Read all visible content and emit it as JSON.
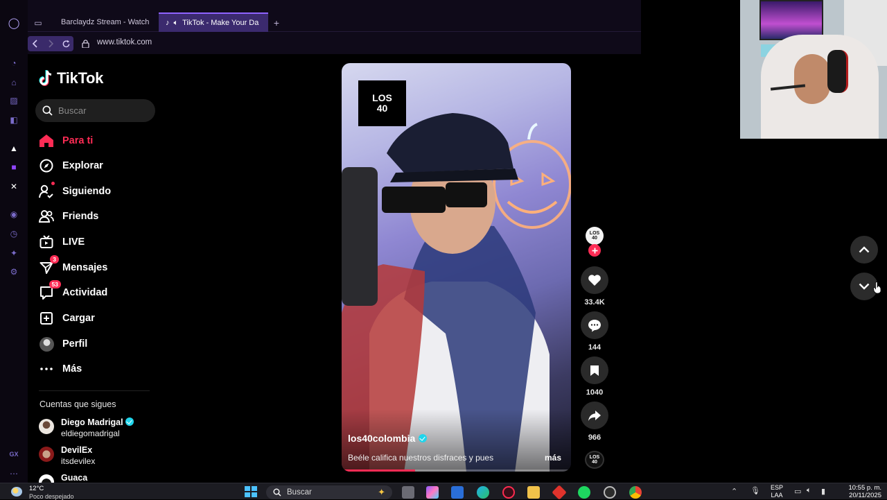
{
  "browser": {
    "tabs": [
      {
        "label": "Barclaydz Stream - Watch",
        "favicon": "kick-logo-icon",
        "color": "#53fc18"
      },
      {
        "label": "TikTok - Make Your Da",
        "favicon": "tiktok-logo-icon",
        "active": true
      }
    ],
    "new_tab_label": "+",
    "url": "www.tiktok.com"
  },
  "tiktok": {
    "logo_text": "TikTok",
    "search": {
      "placeholder": "Buscar"
    },
    "nav": [
      {
        "label": "Para ti",
        "icon": "home-icon",
        "active": true
      },
      {
        "label": "Explorar",
        "icon": "compass-icon"
      },
      {
        "label": "Siguiendo",
        "icon": "following-icon"
      },
      {
        "label": "Friends",
        "icon": "friends-icon"
      },
      {
        "label": "LIVE",
        "icon": "live-tv-icon"
      },
      {
        "label": "Mensajes",
        "icon": "messages-icon",
        "badge": "3"
      },
      {
        "label": "Actividad",
        "icon": "activity-icon",
        "badge": "53"
      },
      {
        "label": "Cargar",
        "icon": "upload-icon"
      },
      {
        "label": "Perfil",
        "icon": "profile-avatar"
      },
      {
        "label": "Más",
        "icon": "more-icon"
      }
    ],
    "following_header": "Cuentas que sigues",
    "following": [
      {
        "name": "Diego Madrigal",
        "username": "eldiegomadrigal",
        "verified": true
      },
      {
        "name": "DevilEx",
        "username": "itsdevilex",
        "verified": false
      },
      {
        "name": "Guaca",
        "username": "",
        "verified": false
      }
    ],
    "video": {
      "brand_logo_text": "LOS 40",
      "author": "los40colombia",
      "verified": true,
      "caption": "Beéle califica nuestros disfraces y pues",
      "more_label": "más",
      "progress": 0.32
    },
    "actions": {
      "likes": "33.4K",
      "comments": "144",
      "saves": "1040",
      "shares": "966"
    },
    "accent_color": "#fe2c55"
  },
  "taskbar": {
    "weather_temp": "12°C",
    "weather_text": "Poco despejado",
    "search_placeholder": "Buscar",
    "lang": "ESP",
    "lang_sub": "LAA",
    "time": "10:55 p. m.",
    "date": "20/11/2025"
  }
}
